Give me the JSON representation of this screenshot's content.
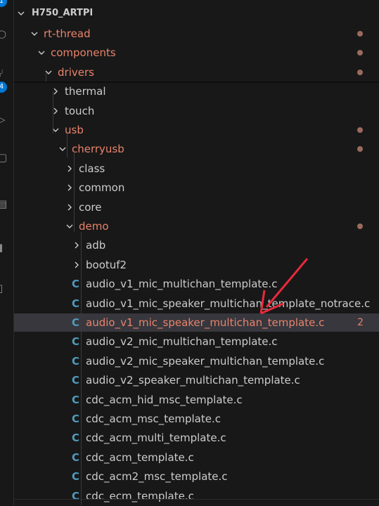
{
  "activity_bar": {
    "badges": [
      "1",
      "4"
    ],
    "icons": [
      "accounts-icon",
      "source-control-icon",
      "run-debug-icon",
      "extensions-icon",
      "remote-icon",
      "testing-icon",
      "terminal-icon"
    ]
  },
  "explorer": {
    "root_label": "H750_ARTPI",
    "items": [
      {
        "label": "rt-thread",
        "type": "folder",
        "open": true,
        "depth": 1,
        "modified": true,
        "dot": true
      },
      {
        "label": "components",
        "type": "folder",
        "open": true,
        "depth": 2,
        "modified": true,
        "dot": true
      },
      {
        "label": "drivers",
        "type": "folder",
        "open": true,
        "depth": 3,
        "modified": true,
        "dot": true
      },
      {
        "label": "thermal",
        "type": "folder",
        "open": false,
        "depth": 4,
        "modified": false
      },
      {
        "label": "touch",
        "type": "folder",
        "open": false,
        "depth": 4,
        "modified": false
      },
      {
        "label": "usb",
        "type": "folder",
        "open": true,
        "depth": 4,
        "modified": true,
        "dot": true
      },
      {
        "label": "cherryusb",
        "type": "folder",
        "open": true,
        "depth": 5,
        "modified": true,
        "dot": true
      },
      {
        "label": "class",
        "type": "folder",
        "open": false,
        "depth": 6,
        "modified": false
      },
      {
        "label": "common",
        "type": "folder",
        "open": false,
        "depth": 6,
        "modified": false
      },
      {
        "label": "core",
        "type": "folder",
        "open": false,
        "depth": 6,
        "modified": false
      },
      {
        "label": "demo",
        "type": "folder",
        "open": true,
        "depth": 6,
        "modified": true,
        "dot": true
      },
      {
        "label": "adb",
        "type": "folder",
        "open": false,
        "depth": 7,
        "modified": false
      },
      {
        "label": "bootuf2",
        "type": "folder",
        "open": false,
        "depth": 7,
        "modified": false
      },
      {
        "label": "audio_v1_mic_multichan_template.c",
        "type": "file",
        "depth": 7,
        "modified": false
      },
      {
        "label": "audio_v1_mic_speaker_multichan_template_notrace.c",
        "type": "file",
        "depth": 7,
        "modified": false
      },
      {
        "label": "audio_v1_mic_speaker_multichan_template.c",
        "type": "file",
        "depth": 7,
        "modified": true,
        "selected": true,
        "count": "2"
      },
      {
        "label": "audio_v2_mic_multichan_template.c",
        "type": "file",
        "depth": 7,
        "modified": false
      },
      {
        "label": "audio_v2_mic_speaker_multichan_template.c",
        "type": "file",
        "depth": 7,
        "modified": false
      },
      {
        "label": "audio_v2_speaker_multichan_template.c",
        "type": "file",
        "depth": 7,
        "modified": false
      },
      {
        "label": "cdc_acm_hid_msc_template.c",
        "type": "file",
        "depth": 7,
        "modified": false
      },
      {
        "label": "cdc_acm_msc_template.c",
        "type": "file",
        "depth": 7,
        "modified": false
      },
      {
        "label": "cdc_acm_multi_template.c",
        "type": "file",
        "depth": 7,
        "modified": false
      },
      {
        "label": "cdc_acm_template.c",
        "type": "file",
        "depth": 7,
        "modified": false
      },
      {
        "label": "cdc_acm2_msc_template.c",
        "type": "file",
        "depth": 7,
        "modified": false
      },
      {
        "label": "cdc_ecm_template.c",
        "type": "file",
        "depth": 7,
        "modified": false
      }
    ],
    "file_icon_glyph": "C",
    "colors": {
      "modified": "#e8836b",
      "c_icon": "#519aba",
      "selected_bg": "#37373d",
      "annotation_arrow": "#e8293a"
    }
  }
}
